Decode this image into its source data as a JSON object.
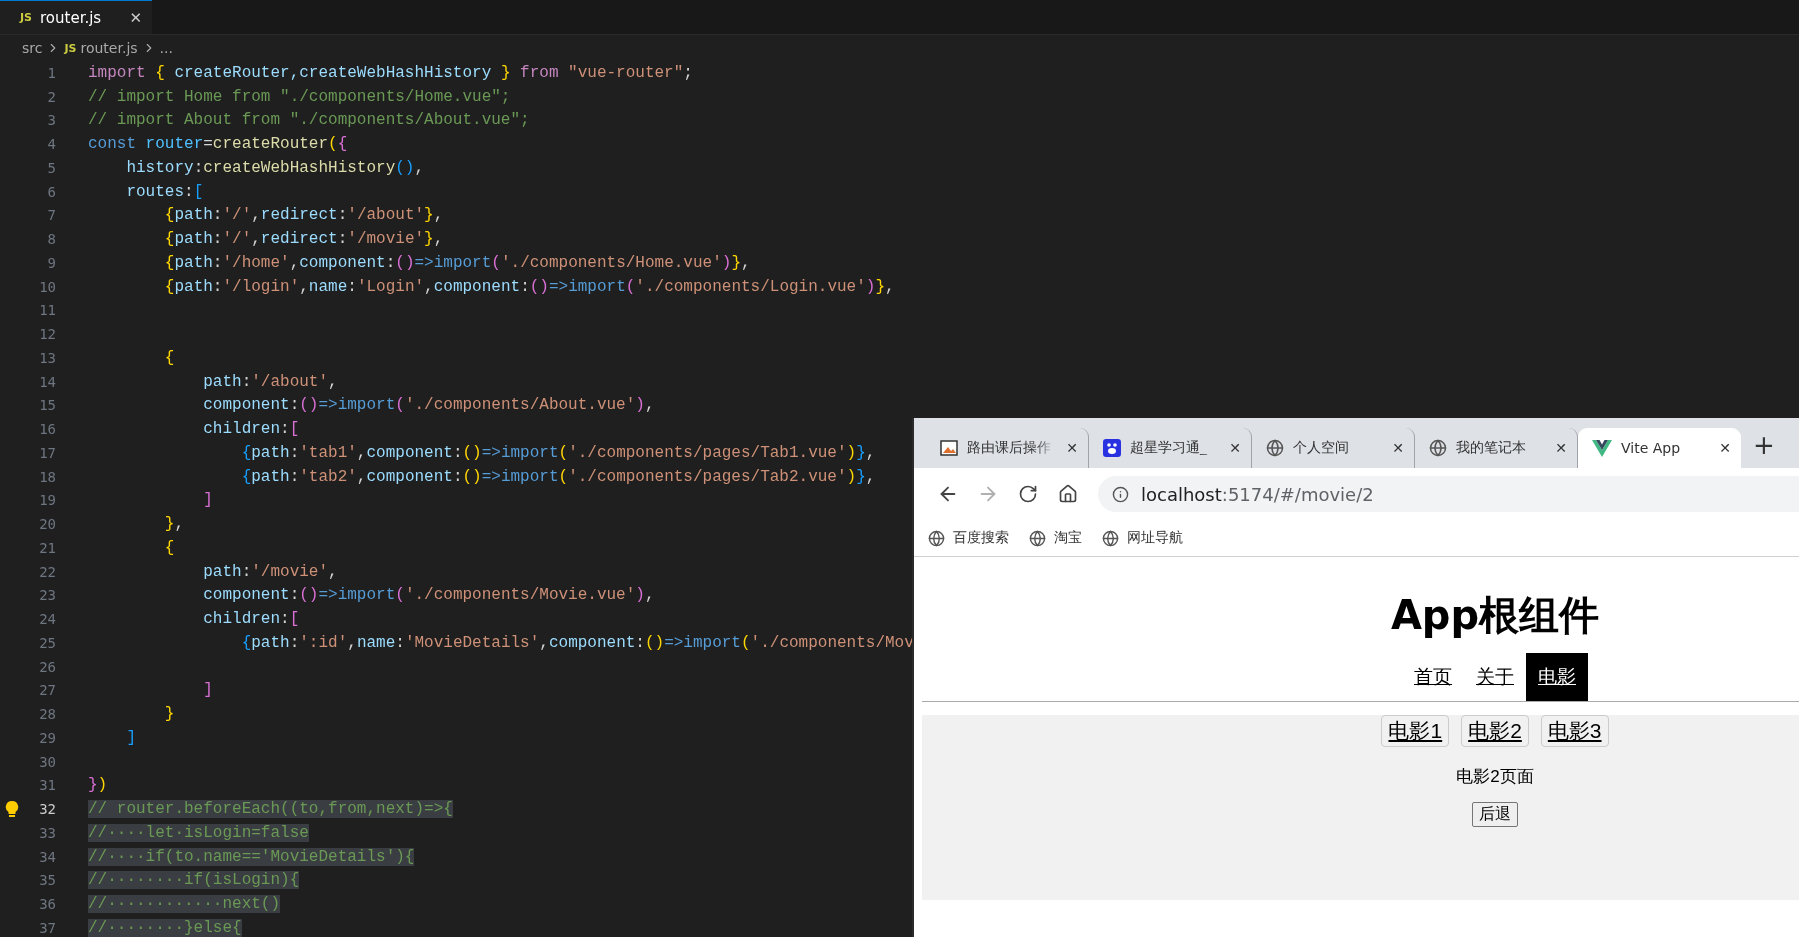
{
  "editor": {
    "tab": {
      "icon_text": "JS",
      "title": "router.js",
      "close": "✕"
    },
    "breadcrumb": {
      "folder": "src",
      "icon_text": "JS",
      "file": "router.js",
      "more": "..."
    },
    "lines": [
      {
        "number": "1",
        "current": false,
        "selected": false,
        "tokens": [
          {
            "text": "import",
            "kind": "control"
          },
          {
            "text": " {",
            "kind": "bracket1"
          },
          {
            "text": " createRouter,createWebHashHistory ",
            "kind": "property"
          },
          {
            "text": "}",
            "kind": "bracket1"
          },
          {
            "text": " from",
            "kind": "control"
          },
          {
            "text": " \"vue-router\"",
            "kind": "string"
          },
          {
            "text": ";",
            "kind": "plain"
          }
        ]
      },
      {
        "number": "2",
        "current": false,
        "selected": false,
        "tokens": [
          {
            "text": "// import Home from \"./components/Home.vue\";",
            "kind": "comment"
          }
        ]
      },
      {
        "number": "3",
        "current": false,
        "selected": false,
        "tokens": [
          {
            "text": "// import About from \"./components/About.vue\";",
            "kind": "comment"
          }
        ]
      },
      {
        "number": "4",
        "current": false,
        "selected": false,
        "tokens": [
          {
            "text": "const",
            "kind": "keyword"
          },
          {
            "text": " router",
            "kind": "variable"
          },
          {
            "text": "=",
            "kind": "plain"
          },
          {
            "text": "createRouter",
            "kind": "function"
          },
          {
            "text": "(",
            "kind": "bracket1"
          },
          {
            "text": "{",
            "kind": "bracket2"
          }
        ]
      },
      {
        "number": "5",
        "current": false,
        "selected": false,
        "tokens": [
          {
            "text": "    history",
            "kind": "property"
          },
          {
            "text": ":",
            "kind": "plain"
          },
          {
            "text": "createWebHashHistory",
            "kind": "function"
          },
          {
            "text": "()",
            "kind": "bracket3"
          },
          {
            "text": ",",
            "kind": "plain"
          }
        ]
      },
      {
        "number": "6",
        "current": false,
        "selected": false,
        "tokens": [
          {
            "text": "    routes",
            "kind": "property"
          },
          {
            "text": ":",
            "kind": "plain"
          },
          {
            "text": "[",
            "kind": "bracket3"
          }
        ]
      },
      {
        "number": "7",
        "current": false,
        "selected": false,
        "tokens": [
          {
            "text": "        {",
            "kind": "bracket1"
          },
          {
            "text": "path",
            "kind": "property"
          },
          {
            "text": ":",
            "kind": "plain"
          },
          {
            "text": "'/'",
            "kind": "string"
          },
          {
            "text": ",",
            "kind": "plain"
          },
          {
            "text": "redirect",
            "kind": "property"
          },
          {
            "text": ":",
            "kind": "plain"
          },
          {
            "text": "'/about'",
            "kind": "string"
          },
          {
            "text": "}",
            "kind": "bracket1"
          },
          {
            "text": ",",
            "kind": "plain"
          }
        ]
      },
      {
        "number": "8",
        "current": false,
        "selected": false,
        "tokens": [
          {
            "text": "        {",
            "kind": "bracket1"
          },
          {
            "text": "path",
            "kind": "property"
          },
          {
            "text": ":",
            "kind": "plain"
          },
          {
            "text": "'/'",
            "kind": "string"
          },
          {
            "text": ",",
            "kind": "plain"
          },
          {
            "text": "redirect",
            "kind": "property"
          },
          {
            "text": ":",
            "kind": "plain"
          },
          {
            "text": "'/movie'",
            "kind": "string"
          },
          {
            "text": "}",
            "kind": "bracket1"
          },
          {
            "text": ",",
            "kind": "plain"
          }
        ]
      },
      {
        "number": "9",
        "current": false,
        "selected": false,
        "tokens": [
          {
            "text": "        {",
            "kind": "bracket1"
          },
          {
            "text": "path",
            "kind": "property"
          },
          {
            "text": ":",
            "kind": "plain"
          },
          {
            "text": "'/home'",
            "kind": "string"
          },
          {
            "text": ",",
            "kind": "plain"
          },
          {
            "text": "component",
            "kind": "property"
          },
          {
            "text": ":",
            "kind": "plain"
          },
          {
            "text": "()",
            "kind": "bracket2"
          },
          {
            "text": "=>import",
            "kind": "keyword"
          },
          {
            "text": "(",
            "kind": "bracket2"
          },
          {
            "text": "'./components/Home.vue'",
            "kind": "string"
          },
          {
            "text": ")",
            "kind": "bracket2"
          },
          {
            "text": "}",
            "kind": "bracket1"
          },
          {
            "text": ",",
            "kind": "plain"
          }
        ]
      },
      {
        "number": "10",
        "current": false,
        "selected": false,
        "tokens": [
          {
            "text": "        {",
            "kind": "bracket1"
          },
          {
            "text": "path",
            "kind": "property"
          },
          {
            "text": ":",
            "kind": "plain"
          },
          {
            "text": "'/login'",
            "kind": "string"
          },
          {
            "text": ",",
            "kind": "plain"
          },
          {
            "text": "name",
            "kind": "property"
          },
          {
            "text": ":",
            "kind": "plain"
          },
          {
            "text": "'Login'",
            "kind": "string"
          },
          {
            "text": ",",
            "kind": "plain"
          },
          {
            "text": "component",
            "kind": "property"
          },
          {
            "text": ":",
            "kind": "plain"
          },
          {
            "text": "()",
            "kind": "bracket2"
          },
          {
            "text": "=>import",
            "kind": "keyword"
          },
          {
            "text": "(",
            "kind": "bracket2"
          },
          {
            "text": "'./components/Login.vue'",
            "kind": "string"
          },
          {
            "text": ")",
            "kind": "bracket2"
          },
          {
            "text": "}",
            "kind": "bracket1"
          },
          {
            "text": ",",
            "kind": "plain"
          }
        ]
      },
      {
        "number": "11",
        "current": false
      },
      {
        "number": "12",
        "current": false
      },
      {
        "number": "13",
        "current": false,
        "selected": false,
        "tokens": [
          {
            "text": "        {",
            "kind": "bracket1"
          }
        ]
      },
      {
        "number": "14",
        "current": false,
        "selected": false,
        "tokens": [
          {
            "text": "            path",
            "kind": "property"
          },
          {
            "text": ":",
            "kind": "plain"
          },
          {
            "text": "'/about'",
            "kind": "string"
          },
          {
            "text": ",",
            "kind": "plain"
          }
        ]
      },
      {
        "number": "15",
        "current": false,
        "selected": false,
        "tokens": [
          {
            "text": "            component",
            "kind": "property"
          },
          {
            "text": ":",
            "kind": "plain"
          },
          {
            "text": "()",
            "kind": "bracket2"
          },
          {
            "text": "=>import",
            "kind": "keyword"
          },
          {
            "text": "(",
            "kind": "bracket2"
          },
          {
            "text": "'./components/About.vue'",
            "kind": "string"
          },
          {
            "text": ")",
            "kind": "bracket2"
          },
          {
            "text": ",",
            "kind": "plain"
          }
        ]
      },
      {
        "number": "16",
        "current": false,
        "selected": false,
        "tokens": [
          {
            "text": "            children",
            "kind": "property"
          },
          {
            "text": ":",
            "kind": "plain"
          },
          {
            "text": "[",
            "kind": "bracket2"
          }
        ]
      },
      {
        "number": "17",
        "current": false,
        "selected": false,
        "tokens": [
          {
            "text": "                {",
            "kind": "bracket3"
          },
          {
            "text": "path",
            "kind": "property"
          },
          {
            "text": ":",
            "kind": "plain"
          },
          {
            "text": "'tab1'",
            "kind": "string"
          },
          {
            "text": ",",
            "kind": "plain"
          },
          {
            "text": "component",
            "kind": "property"
          },
          {
            "text": ":",
            "kind": "plain"
          },
          {
            "text": "()",
            "kind": "bracket1"
          },
          {
            "text": "=>import",
            "kind": "keyword"
          },
          {
            "text": "(",
            "kind": "bracket1"
          },
          {
            "text": "'./components/pages/Tab1.vue'",
            "kind": "string"
          },
          {
            "text": ")",
            "kind": "bracket1"
          },
          {
            "text": "}",
            "kind": "bracket3"
          },
          {
            "text": ",",
            "kind": "plain"
          }
        ]
      },
      {
        "number": "18",
        "current": false,
        "selected": false,
        "tokens": [
          {
            "text": "                {",
            "kind": "bracket3"
          },
          {
            "text": "path",
            "kind": "property"
          },
          {
            "text": ":",
            "kind": "plain"
          },
          {
            "text": "'tab2'",
            "kind": "string"
          },
          {
            "text": ",",
            "kind": "plain"
          },
          {
            "text": "component",
            "kind": "property"
          },
          {
            "text": ":",
            "kind": "plain"
          },
          {
            "text": "()",
            "kind": "bracket1"
          },
          {
            "text": "=>import",
            "kind": "keyword"
          },
          {
            "text": "(",
            "kind": "bracket1"
          },
          {
            "text": "'./components/pages/Tab2.vue'",
            "kind": "string"
          },
          {
            "text": ")",
            "kind": "bracket1"
          },
          {
            "text": "}",
            "kind": "bracket3"
          },
          {
            "text": ",",
            "kind": "plain"
          }
        ]
      },
      {
        "number": "19",
        "current": false,
        "selected": false,
        "tokens": [
          {
            "text": "            ]",
            "kind": "bracket2"
          }
        ]
      },
      {
        "number": "20",
        "current": false,
        "selected": false,
        "tokens": [
          {
            "text": "        }",
            "kind": "bracket1"
          },
          {
            "text": ",",
            "kind": "plain"
          }
        ]
      },
      {
        "number": "21",
        "current": false,
        "selected": false,
        "tokens": [
          {
            "text": "        {",
            "kind": "bracket1"
          }
        ]
      },
      {
        "number": "22",
        "current": false,
        "selected": false,
        "tokens": [
          {
            "text": "            path",
            "kind": "property"
          },
          {
            "text": ":",
            "kind": "plain"
          },
          {
            "text": "'/movie'",
            "kind": "string"
          },
          {
            "text": ",",
            "kind": "plain"
          }
        ]
      },
      {
        "number": "23",
        "current": false,
        "selected": false,
        "tokens": [
          {
            "text": "            component",
            "kind": "property"
          },
          {
            "text": ":",
            "kind": "plain"
          },
          {
            "text": "()",
            "kind": "bracket2"
          },
          {
            "text": "=>import",
            "kind": "keyword"
          },
          {
            "text": "(",
            "kind": "bracket2"
          },
          {
            "text": "'./components/Movie.vue'",
            "kind": "string"
          },
          {
            "text": ")",
            "kind": "bracket2"
          },
          {
            "text": ",",
            "kind": "plain"
          }
        ]
      },
      {
        "number": "24",
        "current": false,
        "selected": false,
        "tokens": [
          {
            "text": "            children",
            "kind": "property"
          },
          {
            "text": ":",
            "kind": "plain"
          },
          {
            "text": "[",
            "kind": "bracket2"
          }
        ]
      },
      {
        "number": "25",
        "current": false,
        "selected": false,
        "tokens": [
          {
            "text": "                {",
            "kind": "bracket3"
          },
          {
            "text": "path",
            "kind": "property"
          },
          {
            "text": ":",
            "kind": "plain"
          },
          {
            "text": "':id'",
            "kind": "string"
          },
          {
            "text": ",",
            "kind": "plain"
          },
          {
            "text": "name",
            "kind": "property"
          },
          {
            "text": ":",
            "kind": "plain"
          },
          {
            "text": "'MovieDetails'",
            "kind": "string"
          },
          {
            "text": ",",
            "kind": "plain"
          },
          {
            "text": "component",
            "kind": "property"
          },
          {
            "text": ":",
            "kind": "plain"
          },
          {
            "text": "()",
            "kind": "bracket1"
          },
          {
            "text": "=>import",
            "kind": "keyword"
          },
          {
            "text": "(",
            "kind": "bracket1"
          },
          {
            "text": "'./components/Mov",
            "kind": "string"
          }
        ]
      },
      {
        "number": "26",
        "current": false
      },
      {
        "number": "27",
        "current": false,
        "selected": false,
        "tokens": [
          {
            "text": "            ]",
            "kind": "bracket2"
          }
        ]
      },
      {
        "number": "28",
        "current": false,
        "selected": false,
        "tokens": [
          {
            "text": "        }",
            "kind": "bracket1"
          }
        ]
      },
      {
        "number": "29",
        "current": false,
        "selected": false,
        "tokens": [
          {
            "text": "    ]",
            "kind": "bracket3"
          }
        ]
      },
      {
        "number": "30",
        "current": false
      },
      {
        "number": "31",
        "current": false,
        "selected": false,
        "tokens": [
          {
            "text": "}",
            "kind": "bracket2"
          },
          {
            "text": ")",
            "kind": "bracket1"
          }
        ]
      },
      {
        "number": "32",
        "current": true,
        "selected": true,
        "tokens": [
          {
            "text": "// router.beforeEach((to,from,next)=>{",
            "kind": "comment"
          }
        ]
      },
      {
        "number": "33",
        "current": false,
        "selected": true,
        "tokens": [
          {
            "text": "//····let·isLogin=false",
            "kind": "comment"
          }
        ]
      },
      {
        "number": "34",
        "current": false,
        "selected": true,
        "tokens": [
          {
            "text": "//····if(to.name=='MovieDetails'){",
            "kind": "comment"
          }
        ]
      },
      {
        "number": "35",
        "current": false,
        "selected": true,
        "tokens": [
          {
            "text": "//········if(isLogin){",
            "kind": "comment"
          }
        ]
      },
      {
        "number": "36",
        "current": false,
        "selected": true,
        "tokens": [
          {
            "text": "//············next()",
            "kind": "comment"
          }
        ]
      },
      {
        "number": "37",
        "current": false,
        "selected": true,
        "tokens": [
          {
            "text": "//········}else{",
            "kind": "comment"
          }
        ]
      }
    ]
  },
  "browser": {
    "tabs": [
      {
        "title": "路由课后操作",
        "kind": "image",
        "selected": false,
        "close": "✕"
      },
      {
        "title": "超星学习通_",
        "kind": "paw",
        "selected": false,
        "close": "✕"
      },
      {
        "title": "个人空间",
        "kind": "globe",
        "selected": false,
        "close": "✕"
      },
      {
        "title": "我的笔记本",
        "kind": "globe",
        "selected": false,
        "close": "✕"
      },
      {
        "title": "Vite App",
        "kind": "vite",
        "selected": true,
        "close": "✕"
      }
    ],
    "new_tab": "+",
    "forward_enabled": false,
    "address": {
      "host": "localhost",
      "rest": ":5174/#/movie/2"
    },
    "bookmarks": [
      "百度搜索",
      "淘宝",
      "网址导航"
    ],
    "page": {
      "heading": "App根组件",
      "nav_links": [
        {
          "label": "首页",
          "selected": false
        },
        {
          "label": "关于",
          "selected": false
        },
        {
          "label": "电影",
          "selected": true
        }
      ],
      "movie_links": [
        "电影1",
        "电影2",
        "电影3"
      ],
      "content": "电影2页面",
      "back_button": "后退"
    }
  }
}
